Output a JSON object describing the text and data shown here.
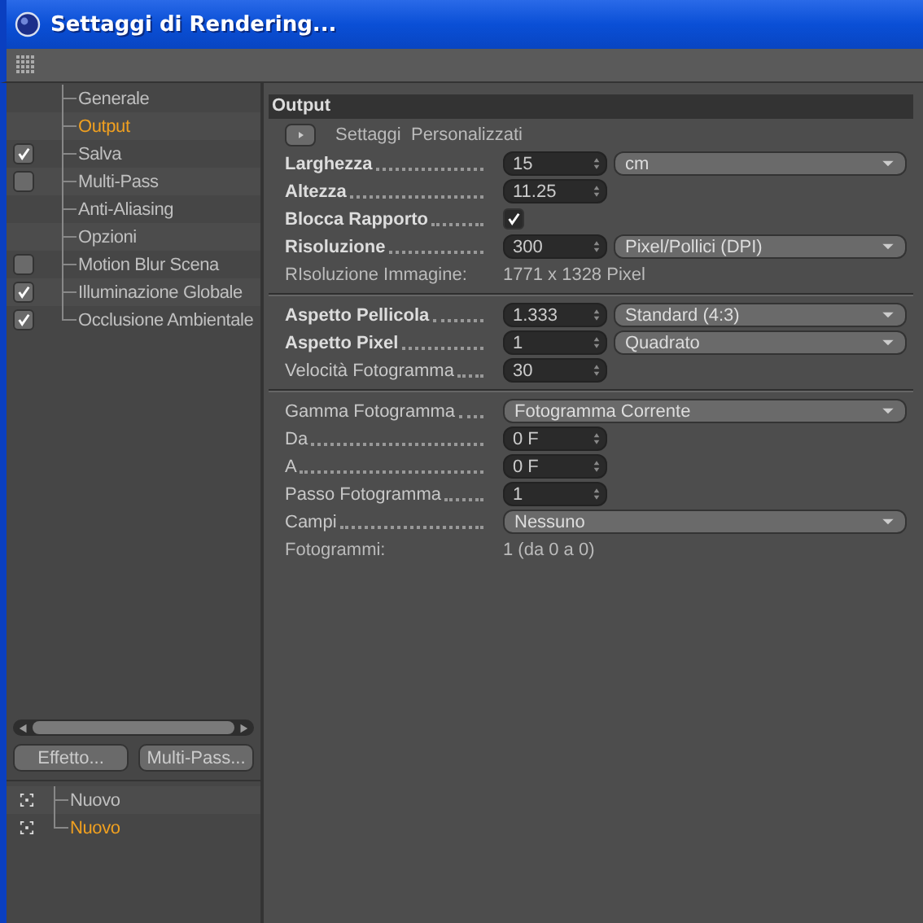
{
  "window": {
    "title": "Settaggi di Rendering..."
  },
  "sidebar": {
    "items": [
      {
        "label": "Generale",
        "kind": "plain",
        "selected": false
      },
      {
        "label": "Output",
        "kind": "plain",
        "selected": true
      },
      {
        "label": "Salva",
        "kind": "toggle",
        "checked": true,
        "selected": false
      },
      {
        "label": "Multi-Pass",
        "kind": "toggle",
        "checked": false,
        "selected": false
      },
      {
        "label": "Anti-Aliasing",
        "kind": "plain",
        "selected": false
      },
      {
        "label": "Opzioni",
        "kind": "plain",
        "selected": false
      },
      {
        "label": "Motion Blur Scena",
        "kind": "toggle",
        "checked": false,
        "selected": false
      },
      {
        "label": "Illuminazione Globale",
        "kind": "toggle",
        "checked": true,
        "selected": false
      },
      {
        "label": "Occlusione Ambientale",
        "kind": "toggle",
        "checked": true,
        "selected": false
      }
    ],
    "buttons": [
      "Effetto...",
      "Multi-Pass..."
    ],
    "effects": [
      {
        "label": "Nuovo",
        "selected": false
      },
      {
        "label": "Nuovo",
        "selected": true
      }
    ]
  },
  "panel": {
    "title": "Output",
    "preset": "Settaggi  Personalizzati",
    "sections": [
      [
        {
          "kind": "spinner",
          "label": "Larghezza",
          "bold": true,
          "value": "15",
          "dropdown": "cm"
        },
        {
          "kind": "spinner",
          "label": "Altezza",
          "bold": true,
          "value": "11.25"
        },
        {
          "kind": "checkbox",
          "label": "Blocca Rapporto",
          "bold": true,
          "checked": true
        },
        {
          "kind": "spinner",
          "label": "Risoluzione",
          "bold": true,
          "value": "300",
          "dropdown": "Pixel/Pollici (DPI)"
        },
        {
          "kind": "info",
          "label": "RIsoluzione Immagine:",
          "bold": false,
          "value": "1771 x 1328 Pixel"
        }
      ],
      [
        {
          "kind": "spinner",
          "label": "Aspetto Pellicola",
          "bold": true,
          "value": "1.333",
          "dropdown": "Standard (4:3)"
        },
        {
          "kind": "spinner",
          "label": "Aspetto Pixel",
          "bold": true,
          "value": "1",
          "dropdown": "Quadrato"
        },
        {
          "kind": "spinner",
          "label": "Velocità Fotogramma",
          "bold": false,
          "value": "30"
        }
      ],
      [
        {
          "kind": "dropdown",
          "label": "Gamma Fotogramma",
          "bold": false,
          "value": "Fotogramma Corrente"
        },
        {
          "kind": "spinner",
          "label": "Da",
          "bold": false,
          "value": "0 F"
        },
        {
          "kind": "spinner",
          "label": "A",
          "bold": false,
          "value": "0 F"
        },
        {
          "kind": "spinner",
          "label": "Passo Fotogramma",
          "bold": false,
          "value": "1"
        },
        {
          "kind": "dropdown",
          "label": "Campi",
          "bold": false,
          "value": "Nessuno"
        },
        {
          "kind": "info",
          "label": "Fotogrammi:",
          "bold": false,
          "value": "1 (da 0 a 0)"
        }
      ]
    ]
  }
}
